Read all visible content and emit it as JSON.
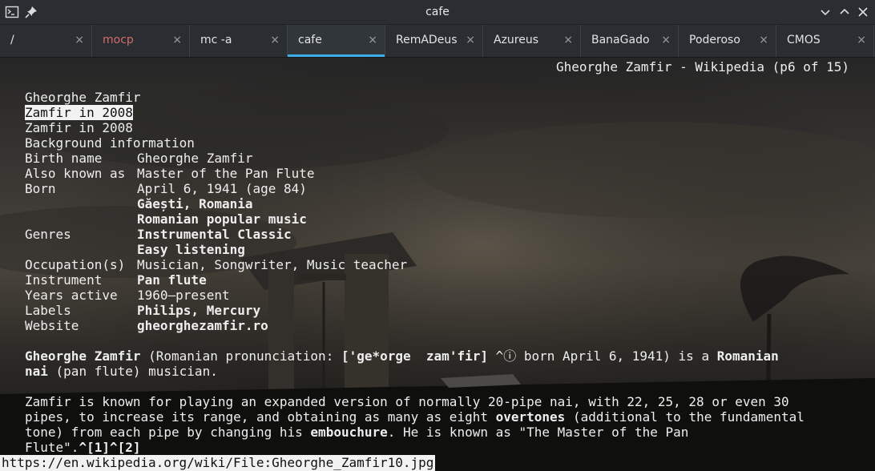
{
  "window": {
    "title": "cafe"
  },
  "tabs": [
    {
      "label": "/",
      "state": "normal"
    },
    {
      "label": "mocp",
      "state": "alert"
    },
    {
      "label": "mc -a",
      "state": "normal"
    },
    {
      "label": "cafe",
      "state": "active"
    },
    {
      "label": "RemADeus",
      "state": "normal"
    },
    {
      "label": "Azureus",
      "state": "normal"
    },
    {
      "label": "BanaGado",
      "state": "normal"
    },
    {
      "label": "Poderoso",
      "state": "normal"
    },
    {
      "label": "CMOS",
      "state": "normal"
    }
  ],
  "close_glyph": "×",
  "colors": {
    "accent": "#3daee9",
    "alert_tab": "#d66b6b",
    "selection_bg": "#f2f2f2"
  },
  "page_header": "Gheorghe Zamfir - Wikipedia (p6 of 15)",
  "infobox": {
    "heading": "Gheorghe Zamfir",
    "caption_selected_first": "Z",
    "caption_selected_rest": "amfir in 2008",
    "caption": "Zamfir in 2008",
    "section": "Background information",
    "rows": {
      "birth_name": {
        "label": "Birth name",
        "value": "Gheorghe Zamfir"
      },
      "aka": {
        "label": "Also known as",
        "value": "Master of the Pan Flute"
      },
      "born": {
        "label": "Born",
        "value": "April 6, 1941 (age 84)",
        "place": "Găești, Romania"
      },
      "genres": {
        "label": "Genres",
        "values": [
          "Romanian popular music",
          "Instrumental Classic",
          "Easy listening"
        ]
      },
      "occupation": {
        "label": "Occupation(s)",
        "value": "Musician, Songwriter, Music teacher"
      },
      "instrument": {
        "label": "Instrument",
        "value": "Pan flute"
      },
      "years": {
        "label": "Years active",
        "value": "1960–present"
      },
      "labels": {
        "label": "Labels",
        "value": "Philips, Mercury"
      },
      "website": {
        "label": "Website",
        "value": "gheorghezamfir.ro"
      }
    }
  },
  "para1": {
    "name": "Gheorghe Zamfir",
    "t1": " (Romanian pronunciation: ",
    "ipa": "['ge*orge  zam'fir]",
    "t2": " ^ⓘ born April 6, 1941) is a ",
    "link": "Romanian",
    "nai": "nai",
    "t3": " (pan flute) musician."
  },
  "para2": {
    "l1": "Zamfir is known for playing an expanded version of normally 20-pipe nai, with 22, 25, 28 or even 30",
    "l2a": "pipes, to increase its range, and obtaining as many as eight ",
    "overtones": "overtones",
    "l2b": " (additional to the fundamental",
    "l3a": "tone) from each pipe by changing his ",
    "embouchure": "embouchure",
    "l3b": ". He is known as \"The Master of the Pan",
    "l4a": "Flute\".",
    "refs": "^[1]^[2]"
  },
  "status_url": "https://en.wikipedia.org/wiki/File:Gheorghe_Zamfir10.jpg"
}
